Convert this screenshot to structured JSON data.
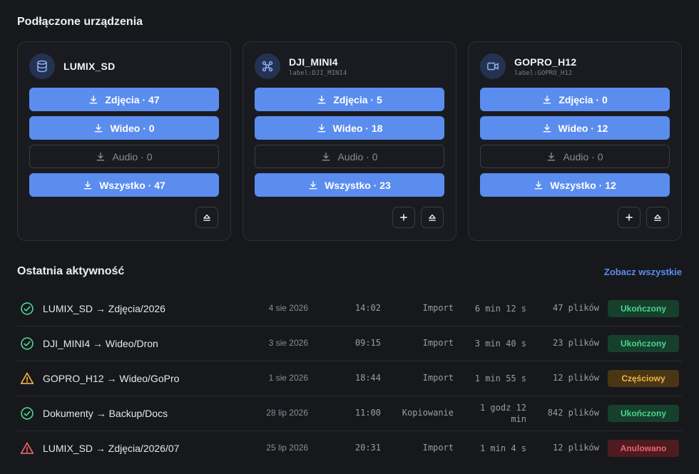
{
  "devices_title": "Podłączone urządzenia",
  "activity_title": "Ostatnia aktywność",
  "see_all": "Zobacz wszystkie",
  "devices": [
    {
      "name": "LUMIX_SD",
      "label": "",
      "icon": "database-icon",
      "photos": "Zdjęcia · 47",
      "video": "Wideo · 0",
      "audio": "Audio · 0",
      "all": "Wszystko · 47"
    },
    {
      "name": "DJI_MINI4",
      "label": "label:DJI_MINI4",
      "icon": "drone-icon",
      "photos": "Zdjęcia · 5",
      "video": "Wideo · 18",
      "audio": "Audio · 0",
      "all": "Wszystko · 23"
    },
    {
      "name": "GOPRO_H12",
      "label": "label:GOPRO_H12",
      "icon": "video-camera-icon",
      "photos": "Zdjęcia · 0",
      "video": "Wideo · 12",
      "audio": "Audio · 0",
      "all": "Wszystko · 12"
    }
  ],
  "activity": [
    {
      "status": "done",
      "route": "LUMIX_SD → Zdjęcia/2026",
      "date": "4 sie 2026",
      "time": "14:02",
      "kind": "Import",
      "duration": "6 min 12 s",
      "files": "47 plików",
      "badge": "Ukończony"
    },
    {
      "status": "done",
      "route": "DJI_MINI4 → Wideo/Dron",
      "date": "3 sie 2026",
      "time": "09:15",
      "kind": "Import",
      "duration": "3 min 40 s",
      "files": "23 plików",
      "badge": "Ukończony"
    },
    {
      "status": "partial",
      "route": "GOPRO_H12 → Wideo/GoPro",
      "date": "1 sie 2026",
      "time": "18:44",
      "kind": "Import",
      "duration": "1 min 55 s",
      "files": "12 plików",
      "badge": "Częściowy"
    },
    {
      "status": "done",
      "route": "Dokumenty → Backup/Docs",
      "date": "28 lip 2026",
      "time": "11:00",
      "kind": "Kopiowanie",
      "duration": "1 godz 12 min",
      "files": "842 plików",
      "badge": "Ukończony"
    },
    {
      "status": "cancelled",
      "route": "LUMIX_SD → Zdjęcia/2026/07",
      "date": "25 lip 2026",
      "time": "20:31",
      "kind": "Import",
      "duration": "1 min 4 s",
      "files": "12 plików",
      "badge": "Anulowano"
    }
  ],
  "colors": {
    "accent": "#5b8def",
    "success": "#4ad491",
    "warning": "#f2b444",
    "danger": "#f0636b",
    "background": "#17181c"
  }
}
